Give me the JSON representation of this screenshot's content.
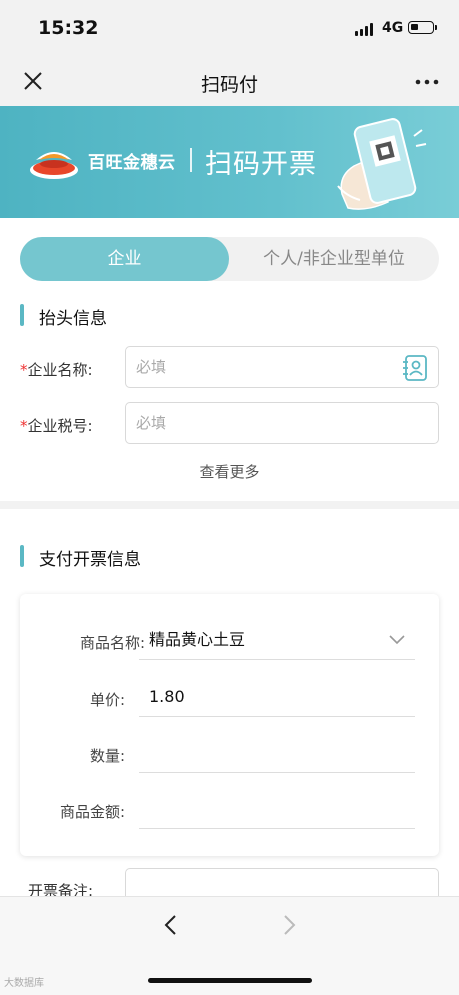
{
  "status": {
    "time": "15:32",
    "network": "4G",
    "battery_level": 0.35
  },
  "nav": {
    "title": "扫码付"
  },
  "banner": {
    "brand": "百旺金穗云",
    "title": "扫码开票"
  },
  "tabs": [
    {
      "label": "企业"
    },
    {
      "label": "个人/非企业型单位"
    }
  ],
  "header_section": {
    "title": "抬头信息",
    "company_name": {
      "required": "*",
      "label": "企业名称:",
      "placeholder": "必填"
    },
    "tax_id": {
      "required": "*",
      "label": "企业税号:",
      "placeholder": "必填"
    },
    "more": "查看更多"
  },
  "payment_section": {
    "title": "支付开票信息",
    "product_name": {
      "label": "商品名称:",
      "value": "精品黄心土豆"
    },
    "unit_price": {
      "label": "单价:",
      "value": "1.80"
    },
    "quantity": {
      "label": "数量:",
      "value": ""
    },
    "amount": {
      "label": "商品金额:",
      "value": ""
    },
    "note": {
      "label": "开票备注:"
    }
  },
  "watermark": "大数据库",
  "colors": {
    "accent": "#75c6cf",
    "banner": "#4eb3c2",
    "required": "#ee3333"
  }
}
